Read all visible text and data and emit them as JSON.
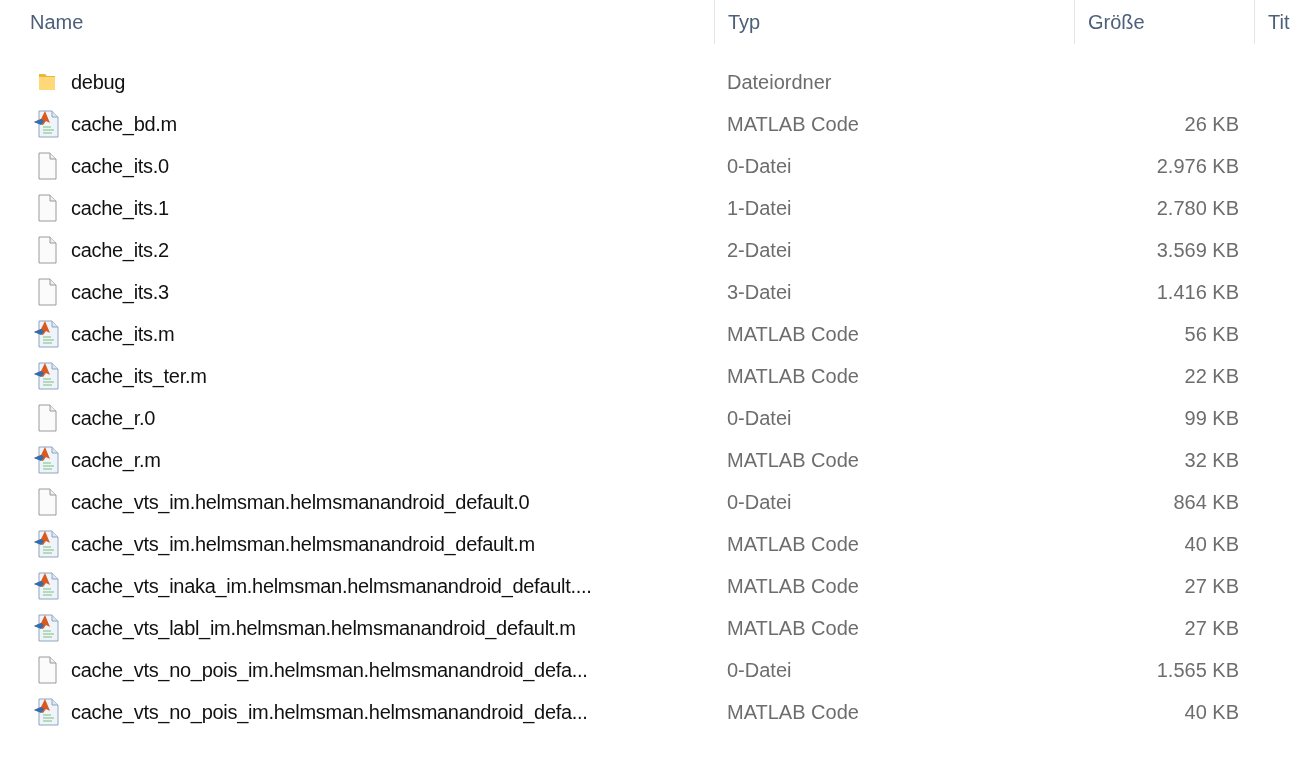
{
  "columns": [
    {
      "label": "Name"
    },
    {
      "label": "Typ"
    },
    {
      "label": "Größe"
    },
    {
      "label": "Tit"
    }
  ],
  "rows": [
    {
      "kind": "folder",
      "name": "debug",
      "type": "Dateiordner"
    },
    {
      "kind": "matlab",
      "name": "cache_bd.m",
      "type": "MATLAB Code",
      "size": "26 KB"
    },
    {
      "kind": "file",
      "name": "cache_its.0",
      "type": "0-Datei",
      "size": "2.976 KB"
    },
    {
      "kind": "file",
      "name": "cache_its.1",
      "type": "1-Datei",
      "size": "2.780 KB"
    },
    {
      "kind": "file",
      "name": "cache_its.2",
      "type": "2-Datei",
      "size": "3.569 KB"
    },
    {
      "kind": "file",
      "name": "cache_its.3",
      "type": "3-Datei",
      "size": "1.416 KB"
    },
    {
      "kind": "matlab",
      "name": "cache_its.m",
      "type": "MATLAB Code",
      "size": "56 KB"
    },
    {
      "kind": "matlab",
      "name": "cache_its_ter.m",
      "type": "MATLAB Code",
      "size": "22 KB"
    },
    {
      "kind": "file",
      "name": "cache_r.0",
      "type": "0-Datei",
      "size": "99 KB"
    },
    {
      "kind": "matlab",
      "name": "cache_r.m",
      "type": "MATLAB Code",
      "size": "32 KB"
    },
    {
      "kind": "file",
      "name": "cache_vts_im.helmsman.helmsmanandroid_default.0",
      "type": "0-Datei",
      "size": "864 KB"
    },
    {
      "kind": "matlab",
      "name": "cache_vts_im.helmsman.helmsmanandroid_default.m",
      "type": "MATLAB Code",
      "size": "40 KB"
    },
    {
      "kind": "matlab",
      "name": "cache_vts_inaka_im.helmsman.helmsmanandroid_default....",
      "type": "MATLAB Code",
      "size": "27 KB"
    },
    {
      "kind": "matlab",
      "name": "cache_vts_labl_im.helmsman.helmsmanandroid_default.m",
      "type": "MATLAB Code",
      "size": "27 KB"
    },
    {
      "kind": "file",
      "name": "cache_vts_no_pois_im.helmsman.helmsmanandroid_defa...",
      "type": "0-Datei",
      "size": "1.565 KB"
    },
    {
      "kind": "matlab",
      "name": "cache_vts_no_pois_im.helmsman.helmsmanandroid_defa...",
      "type": "MATLAB Code",
      "size": "40 KB"
    }
  ]
}
